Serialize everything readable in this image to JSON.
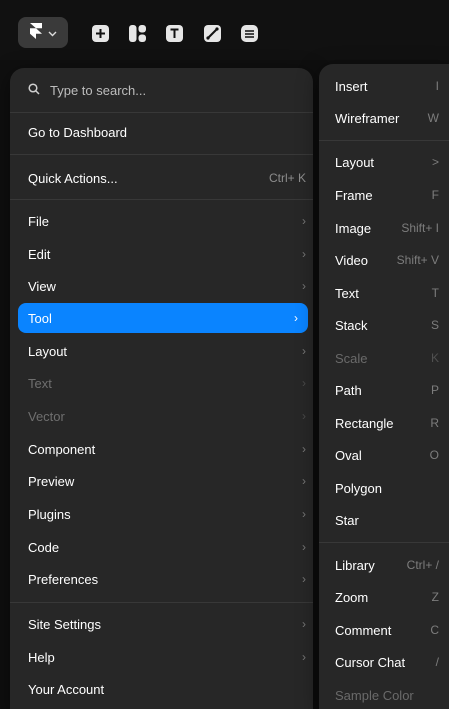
{
  "toolbar": {
    "icons": [
      "framer-logo-icon",
      "chevron-down-icon",
      "insert-plus-icon",
      "layout-icon",
      "text-icon",
      "vector-pen-icon",
      "cms-database-icon"
    ]
  },
  "search": {
    "placeholder": "Type to search..."
  },
  "menu": {
    "dashboard": "Go to Dashboard",
    "quick_actions": {
      "label": "Quick Actions...",
      "shortcut": "Ctrl+ K"
    },
    "items": [
      {
        "label": "File"
      },
      {
        "label": "Edit"
      },
      {
        "label": "View"
      },
      {
        "label": "Tool"
      },
      {
        "label": "Layout"
      },
      {
        "label": "Text"
      },
      {
        "label": "Vector"
      },
      {
        "label": "Component"
      },
      {
        "label": "Preview"
      },
      {
        "label": "Plugins"
      },
      {
        "label": "Code"
      },
      {
        "label": "Preferences"
      }
    ],
    "bottom": [
      {
        "label": "Site Settings"
      },
      {
        "label": "Help"
      },
      {
        "label": "Your Account"
      }
    ],
    "active_color": "#0a84ff"
  },
  "submenu": {
    "items": [
      {
        "label": "Insert",
        "shortcut": "I"
      },
      {
        "label": "Wireframer",
        "shortcut": "W"
      },
      {
        "label": "Layout",
        "shortcut": ">"
      },
      {
        "label": "Frame",
        "shortcut": "F"
      },
      {
        "label": "Image",
        "shortcut": "Shift+ I"
      },
      {
        "label": "Video",
        "shortcut": "Shift+ V"
      },
      {
        "label": "Text",
        "shortcut": "T"
      },
      {
        "label": "Stack",
        "shortcut": "S"
      },
      {
        "label": "Scale",
        "shortcut": "K"
      },
      {
        "label": "Path",
        "shortcut": "P"
      },
      {
        "label": "Rectangle",
        "shortcut": "R"
      },
      {
        "label": "Oval",
        "shortcut": "O"
      },
      {
        "label": "Polygon",
        "shortcut": ""
      },
      {
        "label": "Star",
        "shortcut": ""
      },
      {
        "label": "Library",
        "shortcut": "Ctrl+ /"
      },
      {
        "label": "Zoom",
        "shortcut": "Z"
      },
      {
        "label": "Comment",
        "shortcut": "C"
      },
      {
        "label": "Cursor Chat",
        "shortcut": "/"
      },
      {
        "label": "Sample Color",
        "shortcut": ""
      }
    ]
  }
}
